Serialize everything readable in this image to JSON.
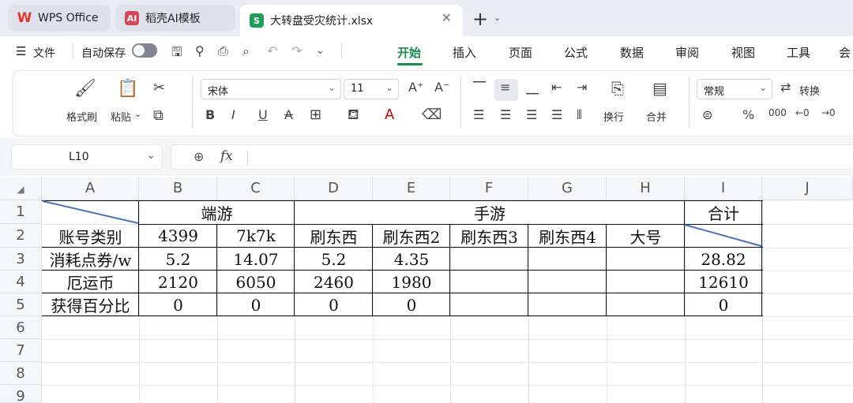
{
  "tabs": [
    {
      "label": "WPS Office",
      "icon": "wps-logo-icon"
    },
    {
      "label": "稻壳AI模板",
      "icon": "daoke-ai-icon"
    },
    {
      "label": "大转盘受灾统计.xlsx",
      "icon": "spreadsheet-s-icon"
    }
  ],
  "menu": {
    "file": "文件",
    "autosave": "自动保存",
    "tabs": [
      "开始",
      "插入",
      "页面",
      "公式",
      "数据",
      "审阅",
      "视图",
      "工具",
      "会"
    ],
    "active_tab": "开始"
  },
  "ribbon": {
    "format_painter": "格式刷",
    "paste": "粘贴",
    "font_name": "宋体",
    "font_size": "11",
    "wrap": "换行",
    "merge": "合并",
    "number_format": "常规",
    "convert": "转换"
  },
  "formula_bar": {
    "name_box": "L10",
    "fx": "fx",
    "formula": ""
  },
  "columns": [
    "A",
    "B",
    "C",
    "D",
    "E",
    "F",
    "G",
    "H",
    "I",
    "J"
  ],
  "rows": [
    "1",
    "2",
    "3",
    "4",
    "5",
    "6",
    "7",
    "8",
    "9"
  ],
  "table": {
    "header_groups": {
      "duanyou": "端游",
      "shouyou": "手游",
      "total": "合计"
    },
    "row_labels": [
      "账号类别",
      "消耗点券/w",
      "厄运币",
      "获得百分比"
    ],
    "accounts": [
      "4399",
      "7k7k",
      "刷东西",
      "刷东西2",
      "刷东西3",
      "刷东西4",
      "大号"
    ],
    "consumed": [
      "5.2",
      "14.07",
      "5.2",
      "4.35",
      "",
      "",
      "",
      "28.82"
    ],
    "coins": [
      "2120",
      "6050",
      "2460",
      "1980",
      "",
      "",
      "",
      "12610"
    ],
    "percent": [
      "0",
      "0",
      "0",
      "0",
      "",
      "",
      "",
      "0"
    ]
  },
  "colors": {
    "accent": "#1a8c4d",
    "diagonal": "#4a6fc0",
    "wps_red": "#e0372b"
  }
}
